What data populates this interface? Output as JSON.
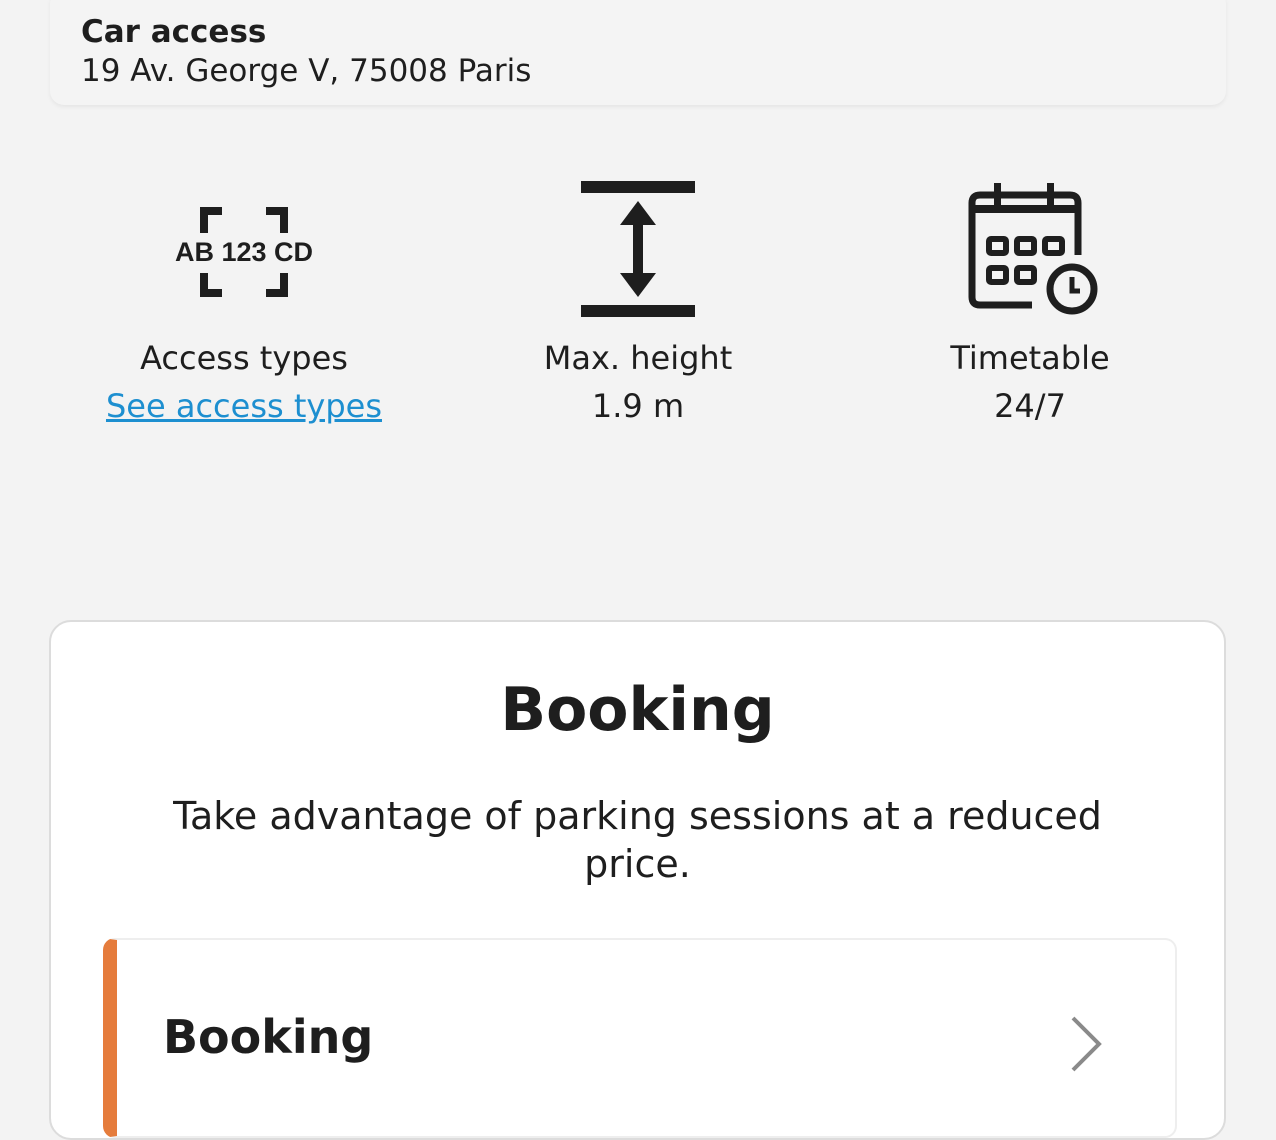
{
  "access": {
    "title": "Car access",
    "address": "19 Av. George V, 75008 Paris"
  },
  "features": {
    "access_types": {
      "icon": "license-plate-icon",
      "plate_text": "AB 123 CD",
      "label": "Access types",
      "link": "See access types"
    },
    "max_height": {
      "icon": "height-arrow-icon",
      "label": "Max. height",
      "value": "1.9 m"
    },
    "timetable": {
      "icon": "calendar-clock-icon",
      "label": "Timetable",
      "value": "24/7"
    }
  },
  "booking": {
    "title": "Booking",
    "description": "Take advantage of parking sessions at a reduced price.",
    "option_label": "Booking",
    "option_icon": "chevron-right-icon"
  },
  "colors": {
    "link": "#1d8fd0",
    "accent": "#e57c3c",
    "background": "#f3f3f3"
  }
}
